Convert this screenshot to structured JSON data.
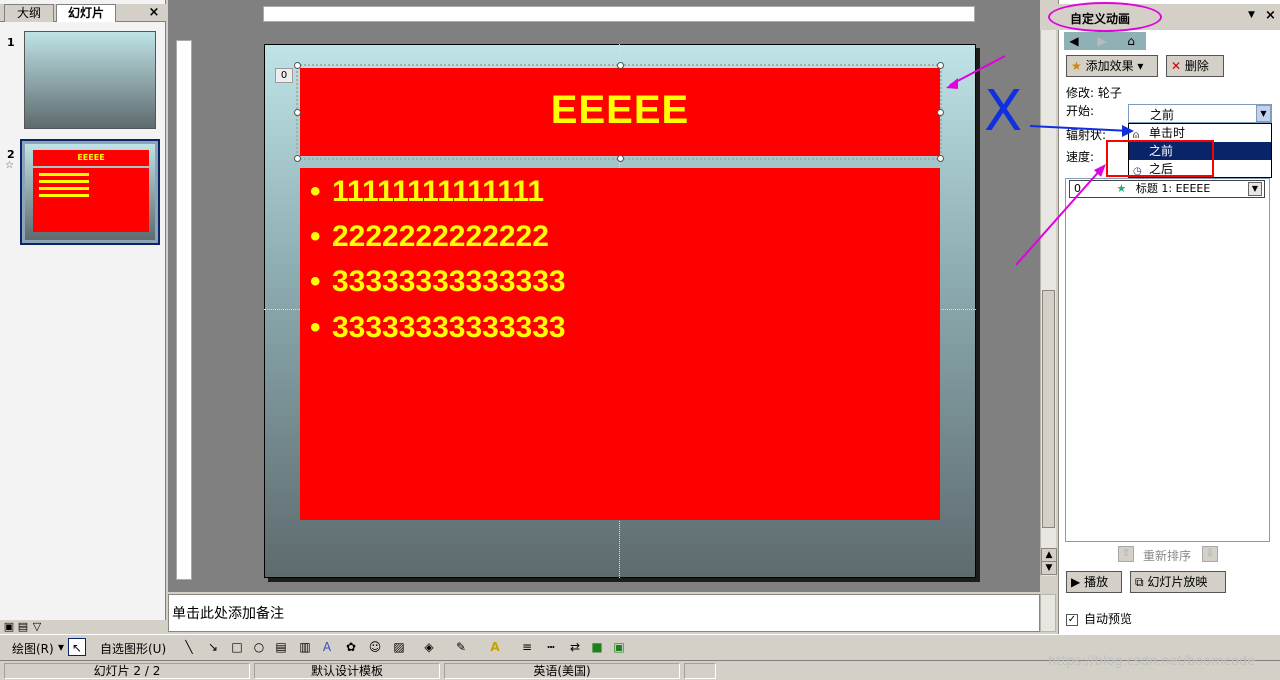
{
  "left_pane": {
    "tabs": [
      "大纲",
      "幻灯片"
    ],
    "close": "×",
    "slides": [
      {
        "number": "1",
        "title": ""
      },
      {
        "number": "2",
        "title": "EEEEE"
      }
    ],
    "star": "☆"
  },
  "slide": {
    "anim_tag": "0",
    "title": "EEEEE",
    "bullets": [
      "11111111111111",
      "2222222222222",
      "33333333333333",
      "33333333333333"
    ],
    "bullet_char": "•"
  },
  "notes": {
    "placeholder": "单击此处添加备注"
  },
  "task_pane": {
    "title": "自定义动画",
    "menu": "▼",
    "close": "×",
    "add_effect": "添加效果",
    "delete": "删除",
    "modify": "修改: 轮子",
    "start_label": "开始:",
    "start_value": "之前",
    "spokes_label": "辐射状:",
    "speed_label": "速度:",
    "dropdown_options": [
      "单击时",
      "之前",
      "之后"
    ],
    "list_item_index": "0",
    "list_item": "标题 1: EEEEE",
    "reorder": "重新排序",
    "play": "播放",
    "slideshow": "幻灯片放映",
    "autopreview": "自动预览"
  },
  "annotations": {
    "x_mark": "X"
  },
  "draw_toolbar": {
    "draw": "绘图(R)",
    "autoshapes": "自选图形(U)"
  },
  "status_bar": {
    "slide_pos": "幻灯片 2 / 2",
    "template": "默认设计模板",
    "language": "英语(美国)"
  },
  "watermark": "https://blog.csdn.net/boomcode",
  "colors": {
    "slide_box": "#ff0000",
    "slide_text": "#ffff00",
    "highlight": "#0a246a",
    "annotation": "#e000e0"
  }
}
